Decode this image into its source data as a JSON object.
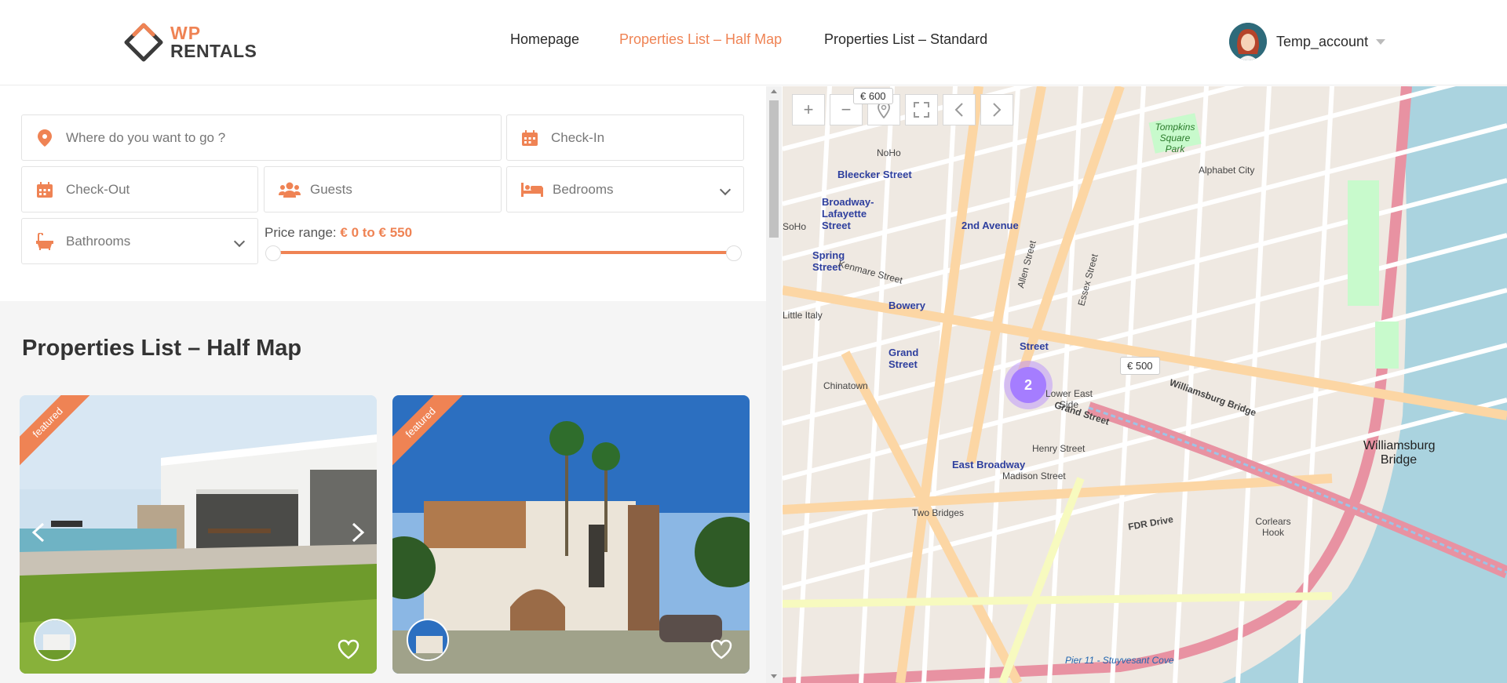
{
  "brand": {
    "line1": "WP",
    "line2": "RENTALS",
    "accent": "#ef8354"
  },
  "nav": {
    "items": [
      {
        "label": "Homepage"
      },
      {
        "label": "Properties List – Half Map",
        "active": true
      },
      {
        "label": "Properties List – Standard"
      }
    ]
  },
  "account": {
    "name": "Temp_account"
  },
  "search": {
    "location_placeholder": "Where do you want to go ?",
    "checkin_placeholder": "Check-In",
    "checkout_placeholder": "Check-Out",
    "guests_placeholder": "Guests",
    "bedrooms_label": "Bedrooms",
    "bathrooms_label": "Bathrooms",
    "price_label": "Price range:",
    "price_value": "€ 0 to € 550",
    "price_min": 0,
    "price_max": 550
  },
  "listing": {
    "title": "Properties List – Half Map",
    "cards": [
      {
        "badge": "featured"
      },
      {
        "badge": "featured"
      }
    ]
  },
  "map": {
    "cluster_count": "2",
    "price_pin": "€ 500",
    "price_pin_top": "€ 600",
    "labels": {
      "bleecker": "Bleecker Street",
      "broadway_lafayette": "Broadway-Lafayette Street",
      "second_ave": "2nd Avenue",
      "spring": "Spring Street",
      "bowery": "Bowery",
      "grand": "Grand Street",
      "delancey": "Street",
      "little_italy": "Little Italy",
      "chinatown": "Chinatown",
      "lower_east_side": "Lower East Side",
      "east_broadway": "East Broadway",
      "two_bridges": "Two Bridges",
      "corlears_hook": "Corlears Hook",
      "williamsburg_bridge": "Williamsburg Bridge",
      "williamsburg_bridge_road": "Williamsburg Bridge",
      "alphabet_city": "Alphabet City",
      "tompkins": "Tompkins Square Park",
      "fdr": "FDR Drive",
      "east_river_pier": "Pier 11 - Stuyvesant Cove",
      "kenmare": "Kenmare Street",
      "grand_street_road": "Grand Street",
      "henry": "Henry Street",
      "madison": "Madison Street",
      "essex": "Essex Street",
      "allen": "Allen Street",
      "noho": "NoHo",
      "soho": "SoHo"
    }
  }
}
